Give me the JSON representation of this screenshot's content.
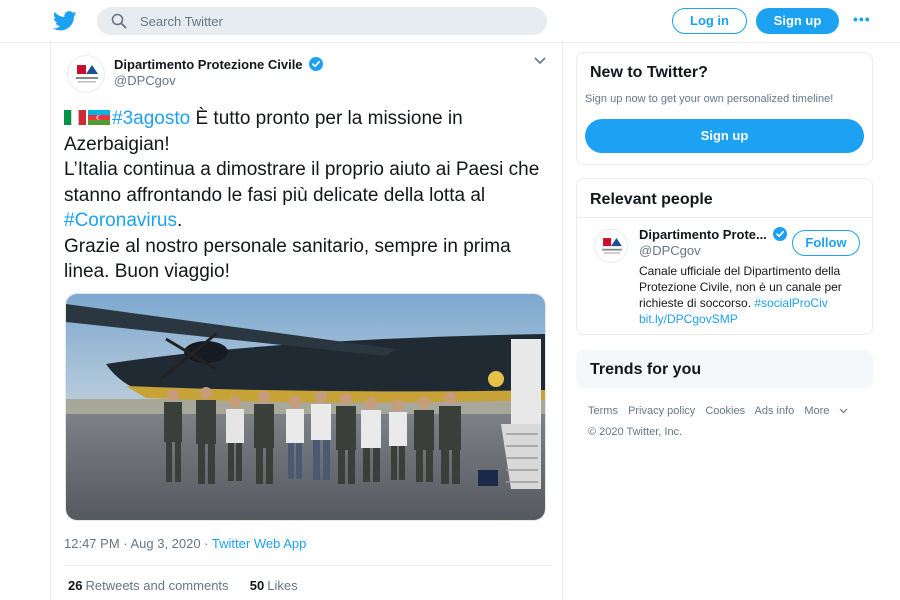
{
  "header": {
    "search_placeholder": "Search Twitter",
    "login_label": "Log in",
    "signup_label": "Sign up",
    "more_label": "•••"
  },
  "tweet": {
    "display_name": "Dipartimento Protezione Civile",
    "handle": "@DPCgov",
    "hashtag_date": "#3agosto",
    "line1_rest": " È tutto pronto per la missione in Azerbaigian!",
    "line2": "L’Italia continua a dimostrare il proprio aiuto ai Paesi che stanno affrontando le fasi più delicate della lotta al ",
    "hashtag_virus": "#Coronavirus",
    "line2_end": ".",
    "line3": "Grazie al nostro personale sanitario, sempre in prima linea. Buon viaggio!",
    "timestamp": "12:47 PM · Aug 3, 2020 · ",
    "source": "Twitter Web App",
    "retweets_count": "26",
    "retweets_label": "Retweets and comments",
    "likes_count": "50",
    "likes_label": "Likes",
    "photo_icon": "group-photo-airplane"
  },
  "sidebar": {
    "new_title": "New to Twitter?",
    "new_sub": "Sign up now to get your own personalized timeline!",
    "new_signup": "Sign up",
    "relevant_title": "Relevant people",
    "rel_name": "Dipartimento Prote...",
    "rel_handle": "@DPCgov",
    "follow_label": "Follow",
    "bio_text": "Canale ufficiale del Dipartimento della Protezione Civile, non è un canale per richieste di soccorso. ",
    "bio_tag": "#socialProCiv",
    "bio_link": "bit.ly/DPCgovSMP",
    "trends_title": "Trends for you"
  },
  "footer": {
    "links": [
      "Terms",
      "Privacy policy",
      "Cookies",
      "Ads info",
      "More"
    ],
    "copyright": "© 2020 Twitter, Inc."
  },
  "colors": {
    "accent": "#1da1f2",
    "text": "#14171a",
    "muted": "#657786"
  }
}
